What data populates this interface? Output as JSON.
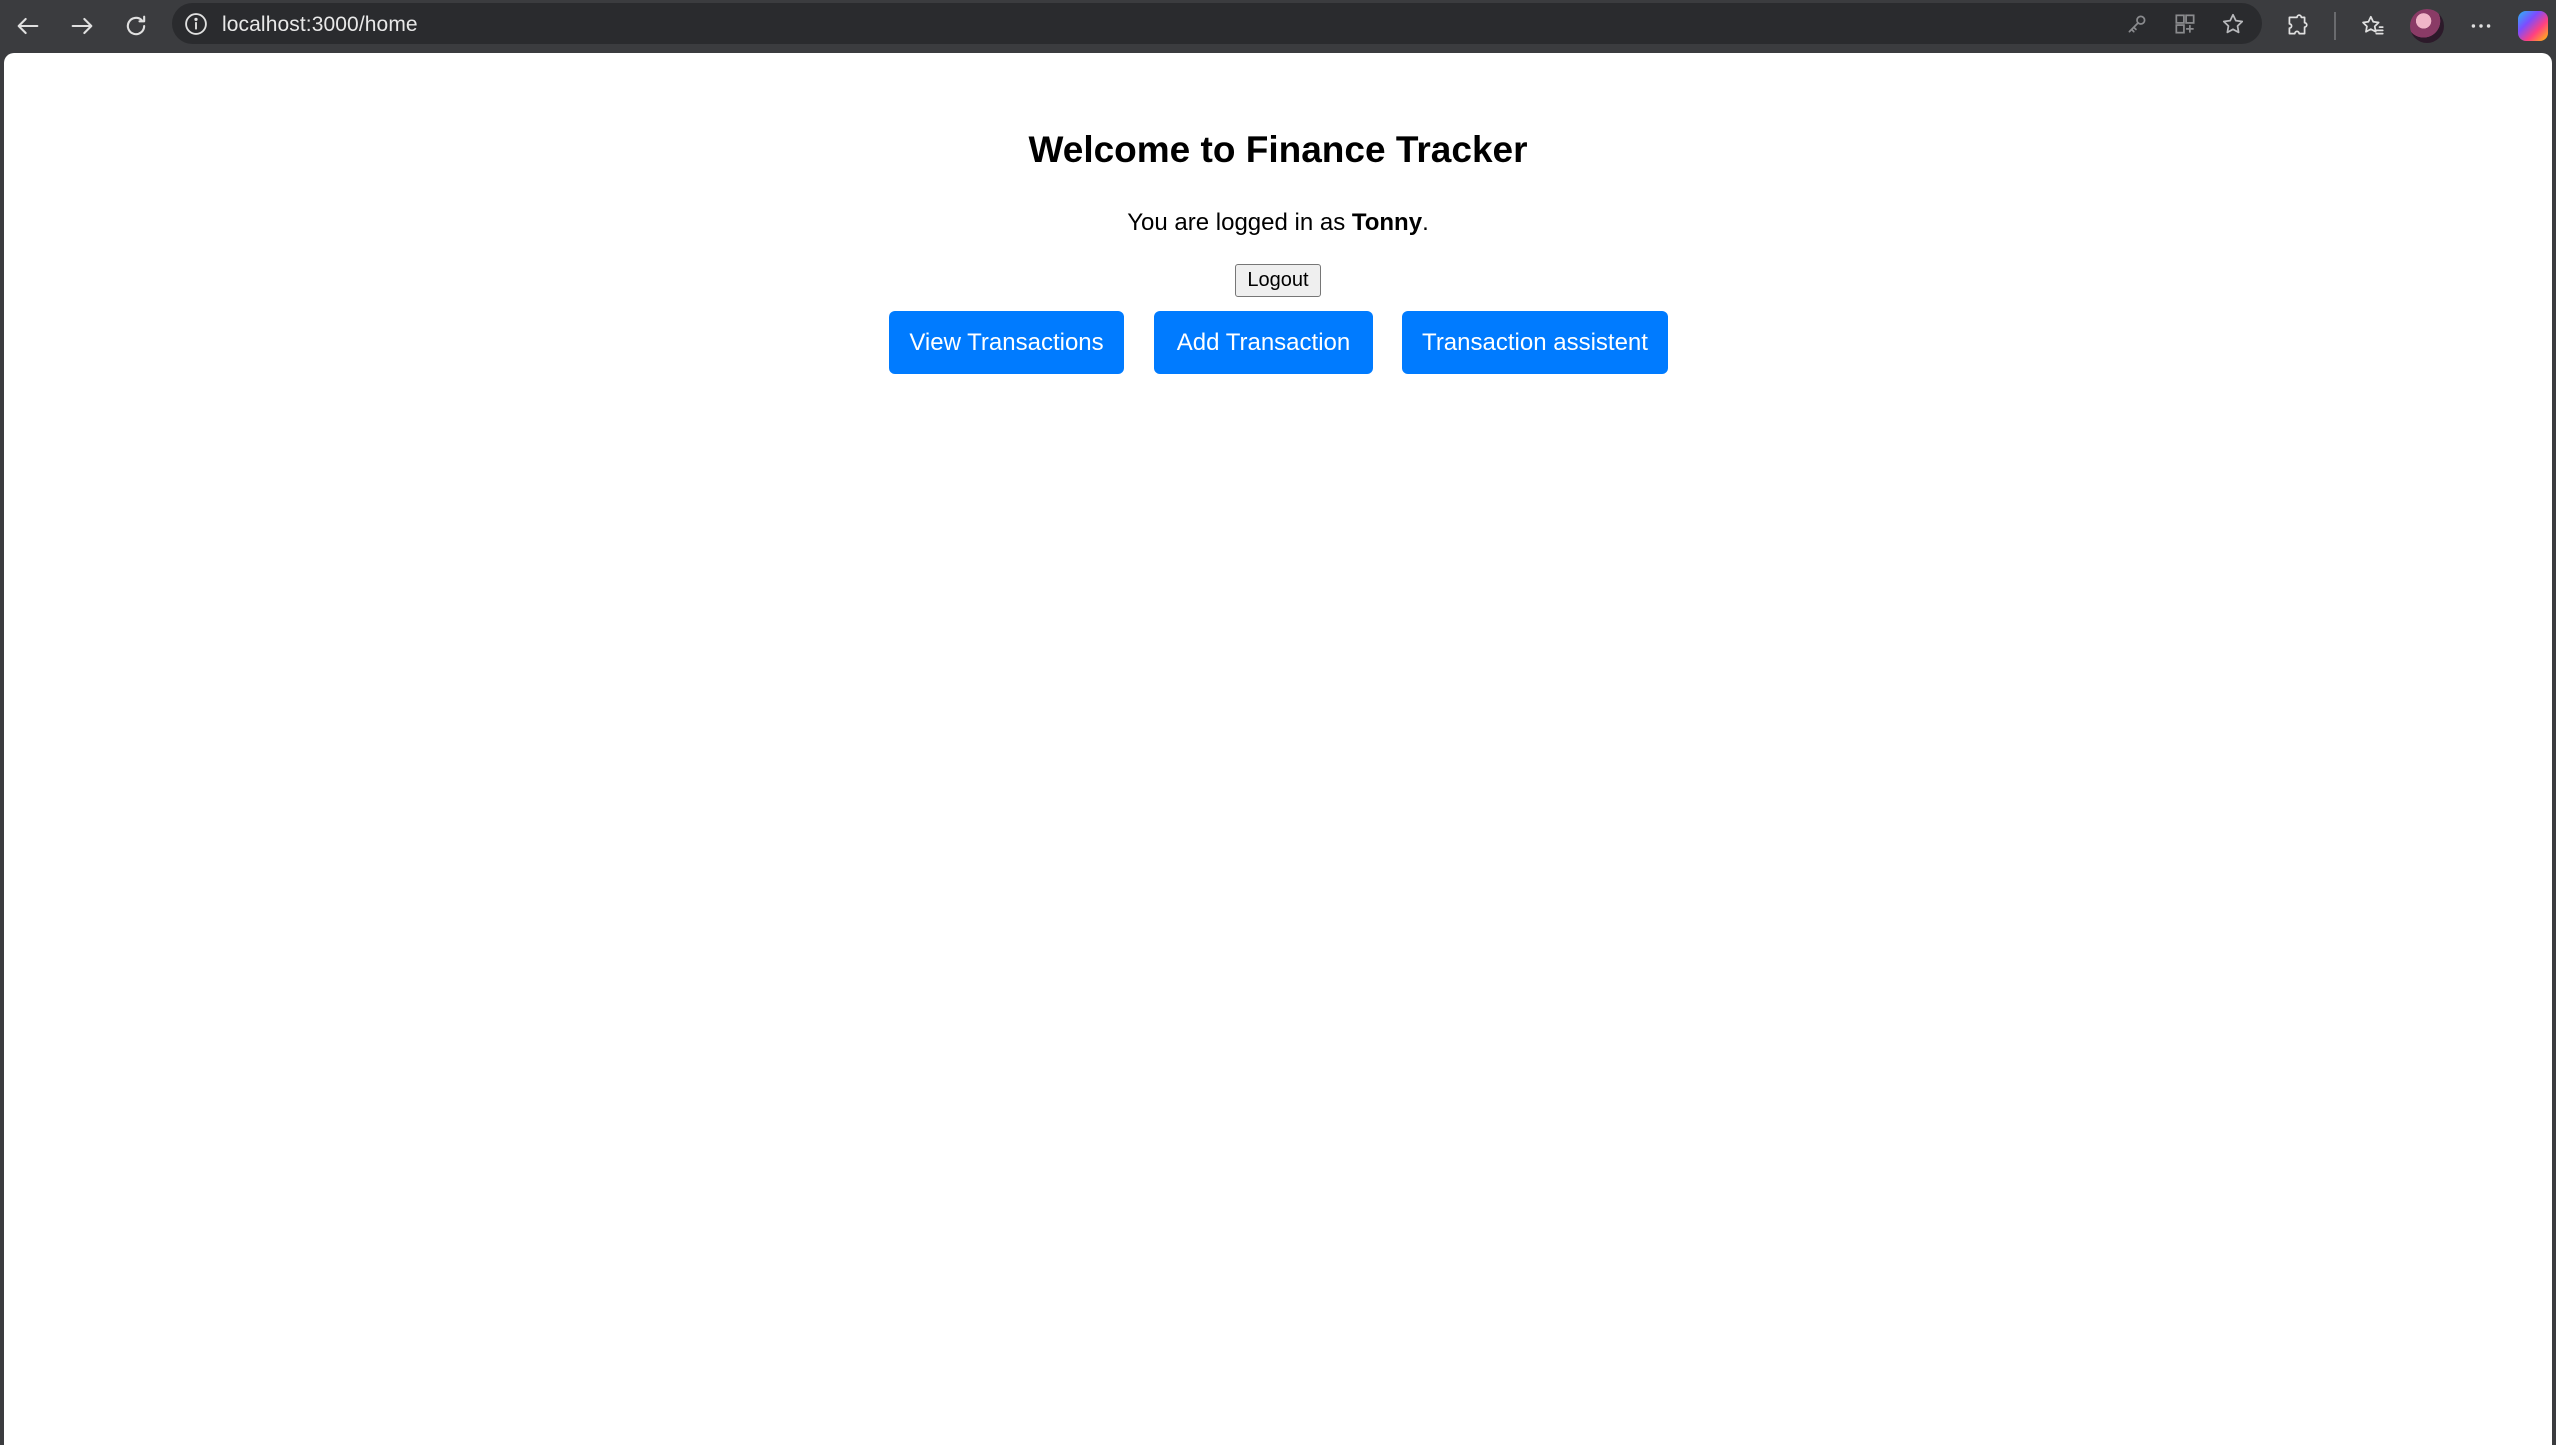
{
  "browser": {
    "url": "localhost:3000/home",
    "accent_color": "#007bff",
    "chrome_color": "#3b3c3f",
    "nav_icons": [
      "back-arrow-icon",
      "forward-arrow-icon",
      "reload-icon"
    ],
    "address_icons": [
      "info-icon",
      "key-icon",
      "app-grid-icon",
      "star-icon"
    ],
    "toolbar_icons": [
      "extensions-icon",
      "favorites-icon",
      "profile-avatar",
      "more-icon",
      "copilot-icon"
    ]
  },
  "page": {
    "title": "Welcome to Finance Tracker",
    "login_prefix": "You are logged in as ",
    "username": "Tonny",
    "login_suffix": ".",
    "logout_label": "Logout",
    "actions": {
      "view_label": "View Transactions",
      "add_label": "Add Transaction",
      "assistant_label": "Transaction assistent"
    }
  }
}
